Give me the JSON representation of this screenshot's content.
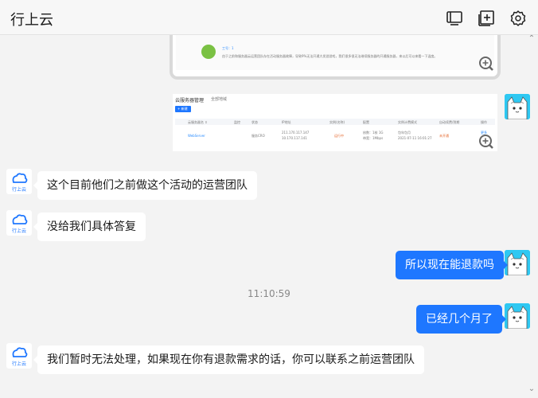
{
  "header": {
    "title": "行上云",
    "icons": [
      "monitor-icon",
      "add-box-icon",
      "settings-icon"
    ]
  },
  "image_msg_1": {
    "label": "工号：1",
    "text": "由于之前和服务器云运营团队存在活动服务器故障，导致9%无法开通大发游游戏，我们很多很无法继续服务器的开通服务器，来以后可以来看一下温度。"
  },
  "image_msg_2": {
    "title": "云服务器管理",
    "region": "全部地域",
    "create_btn": "+ 新建",
    "col_headers": [
      "云服务器名 ⇕",
      "监控",
      "状态",
      "IP地址",
      "实例(名称)",
      "配置",
      "实例计费模式",
      "自动续费/到期",
      "操作"
    ],
    "row": {
      "name": "WebServer",
      "status": "服务CRO",
      "ip": "211.170.117.147",
      "ip2": "10.170.117.141",
      "state": "运行中",
      "config": "核数：1核 1G",
      "config2": "带宽：1Mbps",
      "billing": "包年包月",
      "expiry": "2021-07-11 16:01:27",
      "renew": "未开通",
      "action": "更多"
    }
  },
  "messages": [
    {
      "side": "left",
      "text": "这个目前他们之前做这个活动的运营团队"
    },
    {
      "side": "left",
      "text": "没给我们具体答复"
    },
    {
      "side": "right",
      "text": "所以现在能退款吗"
    },
    {
      "side": "right",
      "text": "已经几个月了"
    },
    {
      "side": "left",
      "text": "我们暂时无法处理，如果现在你有退款需求的话，你可以联系之前运营团队"
    }
  ],
  "timestamp": "11:10:59",
  "logo_text": "行上云",
  "colors": {
    "accent": "#1e77ff",
    "background": "#f3f3f3",
    "avatar_cat_bg": "#2ec8f2"
  }
}
